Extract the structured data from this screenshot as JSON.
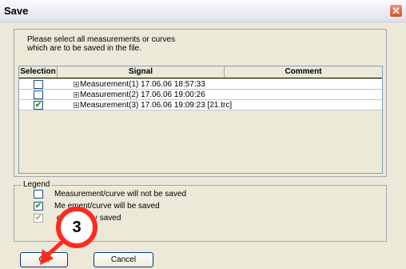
{
  "window": {
    "title": "Save",
    "close_glyph": "✕"
  },
  "instructions": {
    "line1": "Please select all measurements or curves",
    "line2": "which are to be saved in the file."
  },
  "table": {
    "columns": [
      "Selection",
      "Signal",
      "Comment"
    ],
    "rows": [
      {
        "checked": false,
        "signal": "Measurement(1)  17.06.06 18:57:33",
        "comment": ""
      },
      {
        "checked": false,
        "signal": "Measurement(2)  17.06.06 19:00:26",
        "comment": ""
      },
      {
        "checked": true,
        "signal": "Measurement(3)  17.06.06 19:09:23 [21.trc]",
        "comment": ""
      }
    ]
  },
  "legend": {
    "title": "Legend",
    "items": [
      {
        "state": "unchecked",
        "label": "Measurement/curve will not be saved"
      },
      {
        "state": "checked",
        "label": "Me        ement/curve will be saved"
      },
      {
        "state": "partial",
        "label": "          ent partially saved"
      }
    ]
  },
  "buttons": {
    "ok": "Ok",
    "cancel": "Cancel"
  },
  "annotation": {
    "step_number": "3",
    "color": "#ff2a1e"
  },
  "icons": {
    "check": "✔",
    "expand": "+"
  }
}
